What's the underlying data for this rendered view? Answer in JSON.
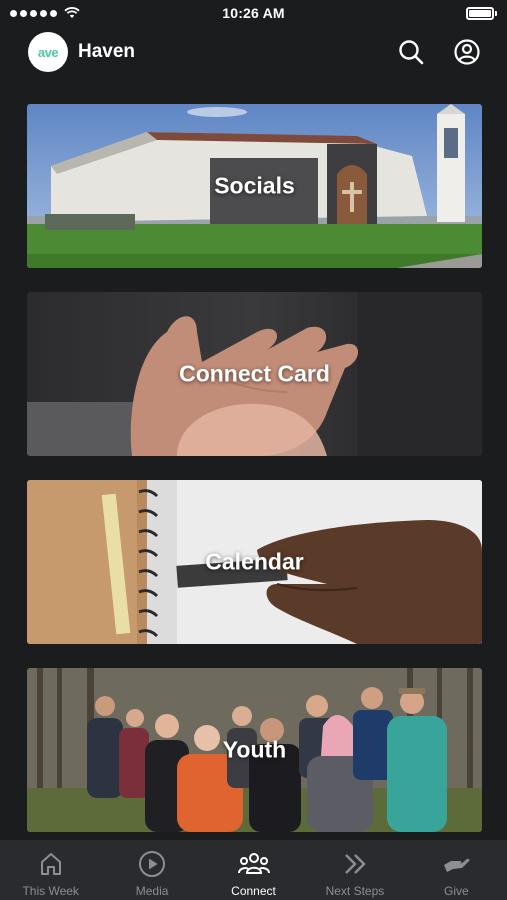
{
  "status_bar": {
    "time": "10:26 AM"
  },
  "header": {
    "logo_text": "ave",
    "title": "Haven"
  },
  "cards": [
    {
      "label": "Socials"
    },
    {
      "label": "Connect Card"
    },
    {
      "label": "Calendar"
    },
    {
      "label": "Youth"
    }
  ],
  "tabs": [
    {
      "label": "This Week",
      "icon": "home-icon",
      "active": false
    },
    {
      "label": "Media",
      "icon": "play-circle-icon",
      "active": false
    },
    {
      "label": "Connect",
      "icon": "group-icon",
      "active": true
    },
    {
      "label": "Next Steps",
      "icon": "double-chevron-right-icon",
      "active": false
    },
    {
      "label": "Give",
      "icon": "giving-hand-icon",
      "active": false
    }
  ],
  "colors": {
    "background": "#1b1c1e",
    "tab_bar": "#2a2b2e",
    "tab_inactive": "#8d8e92",
    "logo_accent": "#4fc6a6"
  }
}
